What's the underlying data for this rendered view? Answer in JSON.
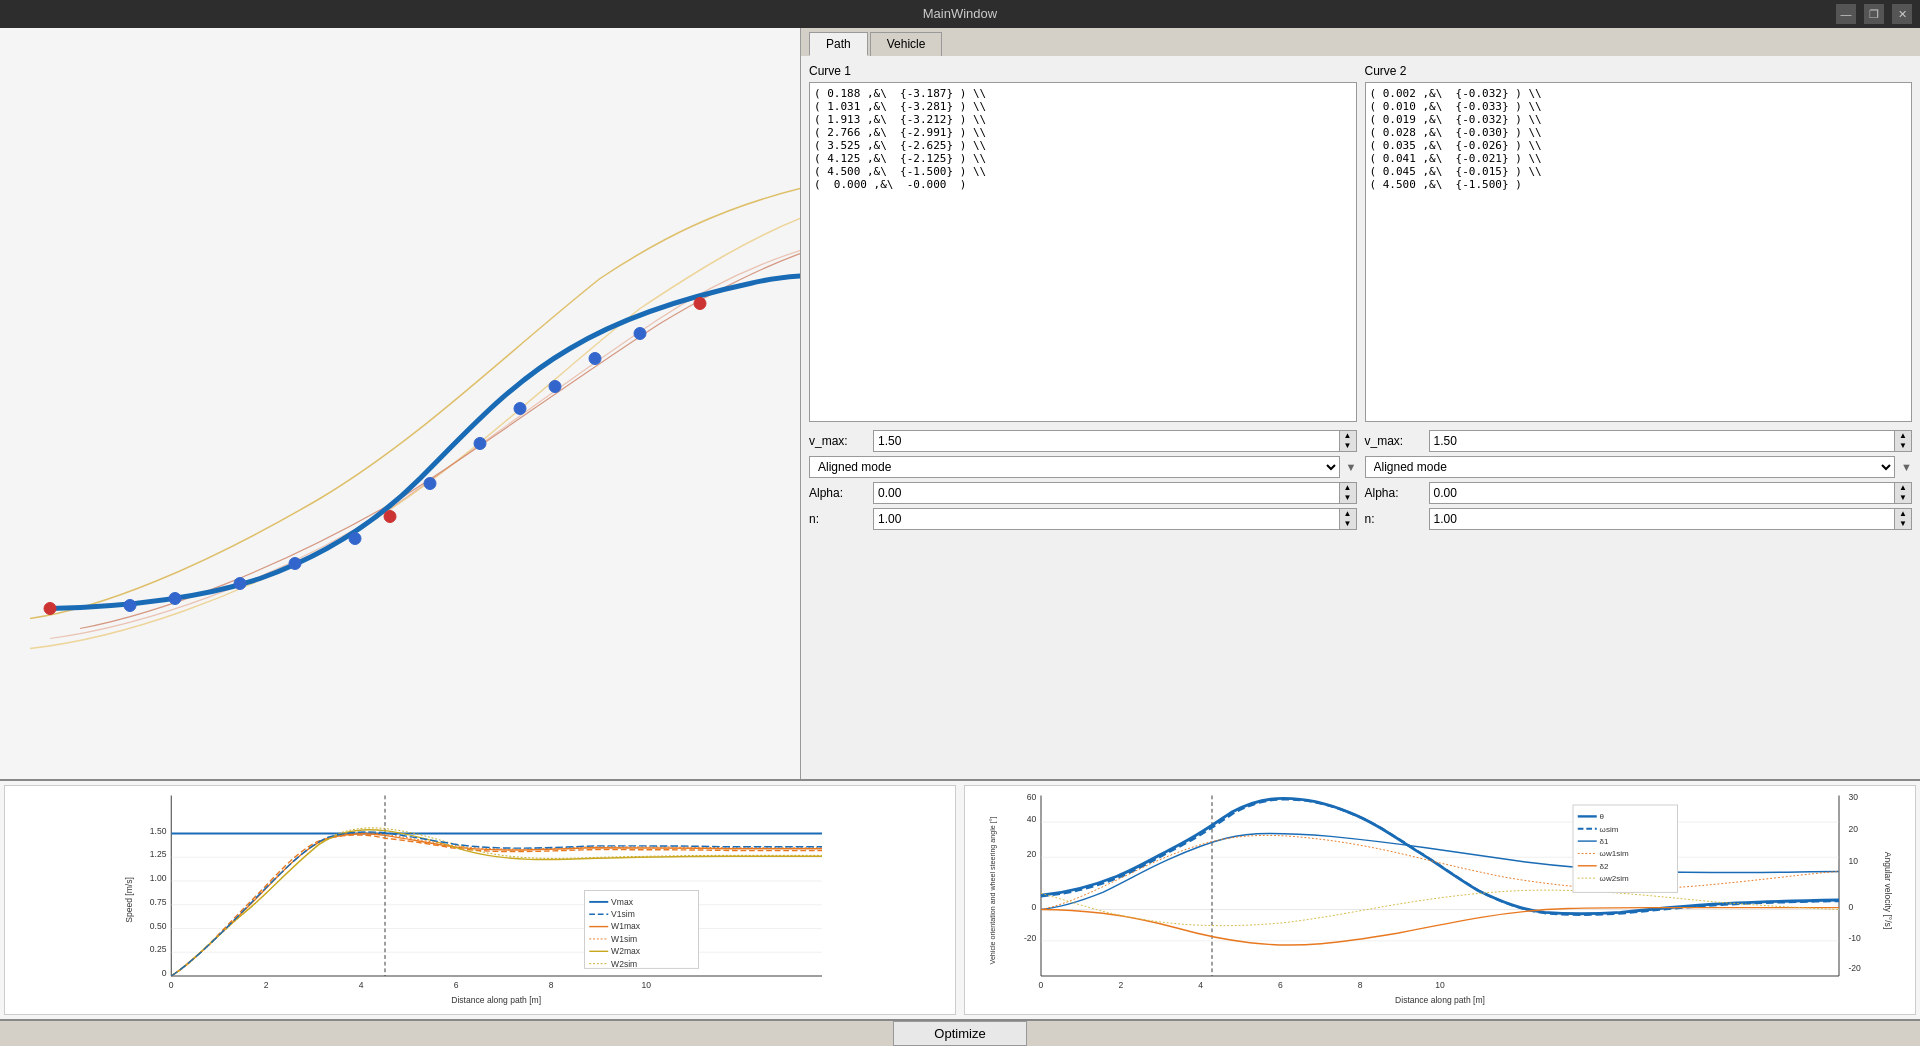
{
  "window": {
    "title": "MainWindow",
    "minimize_btn": "—",
    "restore_btn": "❐",
    "close_btn": "✕"
  },
  "tabs": {
    "path_label": "Path",
    "vehicle_label": "Vehicle"
  },
  "curve1": {
    "title": "Curve 1",
    "content": "( 0.188 ,&\\  {-3.187} ) \\\\\n( 1.031 ,&\\  {-3.281} ) \\\\\n( 1.913 ,&\\  {-3.212} ) \\\\\n( 2.766 ,&\\  {-2.991} ) \\\\\n( 3.525 ,&\\  {-2.625} ) \\\\\n( 4.125 ,&\\  {-2.125} ) \\\\\n( 4.500 ,&\\  {-1.500} ) \\\\\n(  0.000 ,&\\  -0.000  )",
    "vmax_label": "v_max:",
    "vmax_value": "1.50",
    "mode_label": "",
    "mode_value": "Aligned mode",
    "alpha_label": "Alpha:",
    "alpha_value": "0.00",
    "n_label": "n:",
    "n_value": "1.00"
  },
  "curve2": {
    "title": "Curve 2",
    "content": "( 0.002 ,&\\  {-0.032} ) \\\\\n( 0.010 ,&\\  {-0.033} ) \\\\\n( 0.019 ,&\\  {-0.032} ) \\\\\n( 0.028 ,&\\  {-0.030} ) \\\\\n( 0.035 ,&\\  {-0.026} ) \\\\\n( 0.041 ,&\\  {-0.021} ) \\\\\n( 0.045 ,&\\  {-0.015} ) \\\\\n( 4.500 ,&\\  {-1.500} )",
    "vmax_label": "v_max:",
    "vmax_value": "1.50",
    "mode_label": "",
    "mode_value": "Aligned mode",
    "alpha_label": "Alpha:",
    "alpha_value": "0.00",
    "n_label": "n:",
    "n_value": "1.00"
  },
  "chart1": {
    "ylabel": "Speed [m/s]",
    "xlabel": "Distance along path [m]",
    "legend": {
      "vmax": "Vmax",
      "v1sim": "V1sim",
      "w1max": "W1max",
      "w1sim": "W1sim",
      "w2max": "W2max",
      "w2sim": "W2sim"
    }
  },
  "chart2": {
    "ylabel": "Vehicle orientation and wheel steering angle [°]",
    "ylabel2": "Angular velocity [°/s]",
    "xlabel": "Distance along path [m]",
    "legend": {
      "theta": "θ",
      "omega_sim": "ωsim",
      "delta1": "δ1",
      "omegaw1sim": "ωw1sim",
      "delta2": "δ2",
      "omegaw2sim": "ωw2sim"
    }
  },
  "optimize": {
    "button_label": "Optimize"
  }
}
